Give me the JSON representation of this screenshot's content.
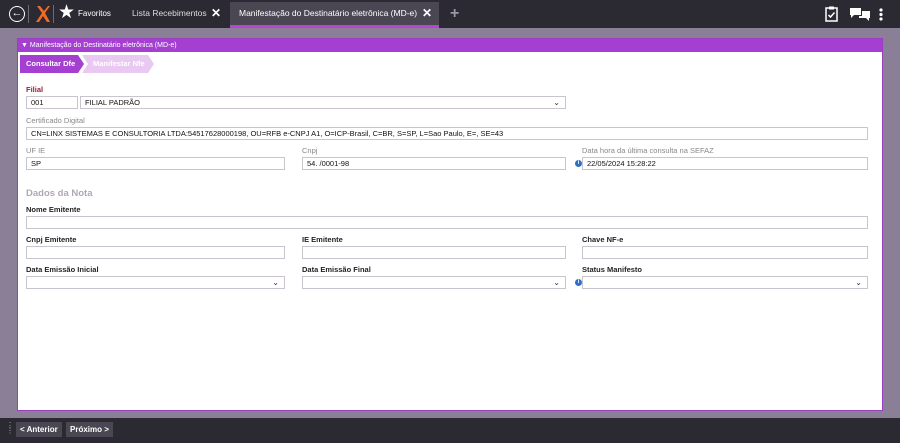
{
  "topbar": {
    "back_icon": "back-arrow-icon",
    "favorites_label": "Favoritos",
    "tabs": [
      {
        "label": "Lista Recebimentos",
        "active": false
      },
      {
        "label": "Manifestação do Destinatário eletrônica (MD-e)",
        "active": true
      }
    ],
    "add_tab_icon": "plus-icon",
    "right_icons": [
      "clipboard-check-icon",
      "chat-icon",
      "more-vertical-icon"
    ]
  },
  "panel": {
    "title": "Manifestação do Destinatário eletrônica (MD-e)",
    "steps": [
      "Consultar Dfe",
      "Manifestar Nfe"
    ]
  },
  "form": {
    "filial": {
      "label": "Filial",
      "code": "001",
      "name": "FILIAL PADRÃO"
    },
    "certificado": {
      "label": "Certificado Digital",
      "value": "CN=LINX SISTEMAS E CONSULTORIA LTDA:54517628000198, OU=RFB e-CNPJ A1, O=ICP-Brasil, C=BR, S=SP, L=Sao Paulo, E=, SE=43"
    },
    "uf_ie": {
      "label": "UF IE",
      "value": "SP"
    },
    "cnpj": {
      "label": "Cnpj",
      "value": "54.            /0001-98"
    },
    "ultima_consulta": {
      "label": "Data hora da última consulta na SEFAZ",
      "value": "22/05/2024 15:28:22"
    }
  },
  "dados_nota": {
    "section_title": "Dados da Nota",
    "nome_emitente": {
      "label": "Nome Emitente",
      "value": ""
    },
    "cnpj_emitente": {
      "label": "Cnpj Emitente",
      "value": ""
    },
    "ie_emitente": {
      "label": "IE Emitente",
      "value": ""
    },
    "chave_nfe": {
      "label": "Chave NF-e",
      "value": ""
    },
    "data_emissao_inicial": {
      "label": "Data Emissão Inicial",
      "value": ""
    },
    "data_emissao_final": {
      "label": "Data Emissão Final",
      "value": ""
    },
    "status_manifesto": {
      "label": "Status Manifesto",
      "value": ""
    }
  },
  "bottombar": {
    "prev_label": "< Anterior",
    "next_label": "Próximo >"
  },
  "colors": {
    "accent": "#a53fd1",
    "accent_light": "#e9c8f2",
    "topbar_bg": "#2b2a33",
    "background": "#8a7f96",
    "required_label": "#9b1c3b",
    "info_icon": "#2f6fc6"
  }
}
